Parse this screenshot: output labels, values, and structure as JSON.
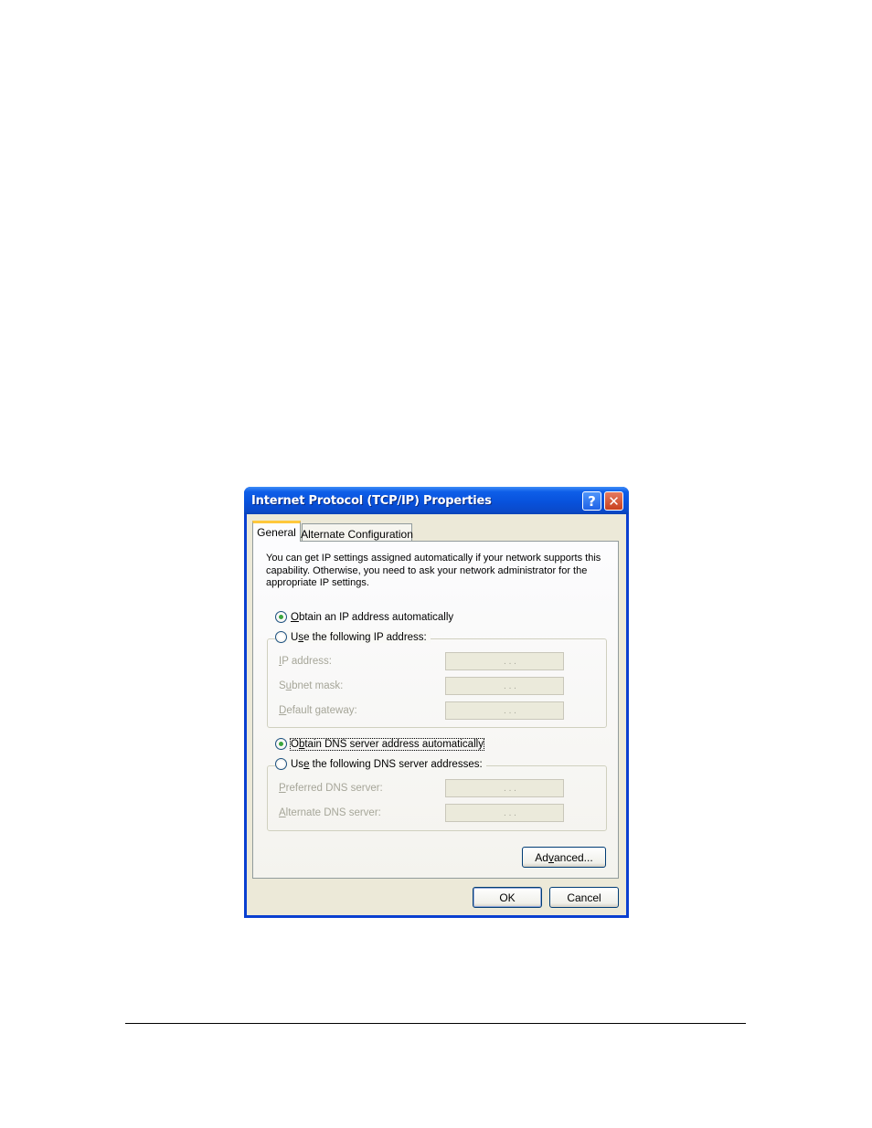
{
  "window": {
    "title": "Internet Protocol (TCP/IP) Properties",
    "help_label": "?",
    "close_label": "✕"
  },
  "tabs": [
    {
      "label": "General",
      "selected": true
    },
    {
      "label": "Alternate Configuration",
      "selected": false
    }
  ],
  "intro_text": "You can get IP settings assigned automatically if your network supports this capability. Otherwise, you need to ask your network administrator for the appropriate IP settings.",
  "ip": {
    "auto_option": {
      "pre": "",
      "key": "O",
      "post": "btain an IP address automatically",
      "checked": true
    },
    "manual_option": {
      "pre": "U",
      "key": "s",
      "post": "e the following IP address:",
      "checked": false
    },
    "fields": [
      {
        "pre": "",
        "key": "I",
        "post": "P address:",
        "value": ".   .   ."
      },
      {
        "pre": "S",
        "key": "u",
        "post": "bnet mask:",
        "value": ".   .   ."
      },
      {
        "pre": "",
        "key": "D",
        "post": "efault gateway:",
        "value": ".   .   ."
      }
    ]
  },
  "dns": {
    "auto_option": {
      "pre": "O",
      "key": "b",
      "post": "tain DNS server address automatically",
      "checked": true
    },
    "manual_option": {
      "pre": "Us",
      "key": "e",
      "post": " the following DNS server addresses:",
      "checked": false
    },
    "fields": [
      {
        "pre": "",
        "key": "P",
        "post": "referred DNS server:",
        "value": ".   .   ."
      },
      {
        "pre": "",
        "key": "A",
        "post": "lternate DNS server:",
        "value": ".   .   ."
      }
    ]
  },
  "buttons": {
    "advanced": {
      "pre": "Ad",
      "key": "v",
      "post": "anced..."
    },
    "ok": "OK",
    "cancel": "Cancel"
  },
  "colors": {
    "title_bar": "#0852dc",
    "dialog_face": "#ece9d8",
    "radio_dot": "#3ba53e",
    "tab_highlight": "#ffc83c"
  }
}
